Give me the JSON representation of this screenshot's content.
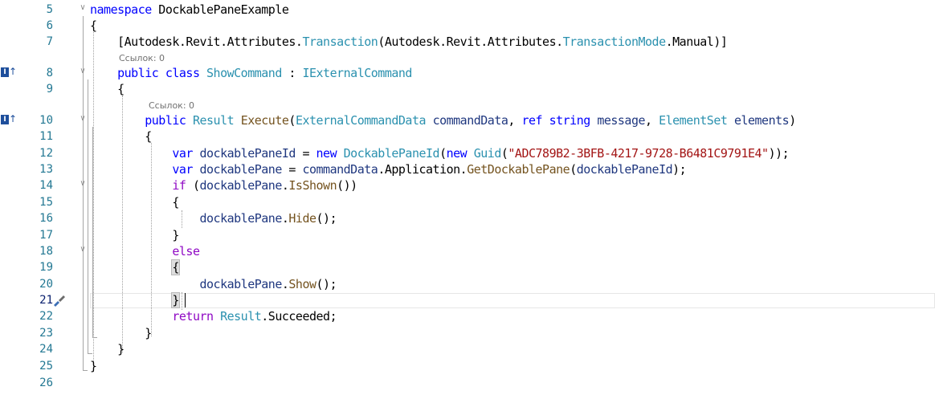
{
  "editor": {
    "lines": [
      {
        "num": "5",
        "tokens": [
          {
            "t": "namespace",
            "c": "kw"
          },
          {
            "t": " DockablePaneExample",
            "c": "ns"
          }
        ]
      },
      {
        "num": "6",
        "tokens": [
          {
            "t": "{",
            "c": ""
          }
        ]
      },
      {
        "num": "7",
        "tokens": [
          {
            "t": "    [Autodesk.Revit.Attributes.",
            "c": ""
          },
          {
            "t": "Transaction",
            "c": "typ"
          },
          {
            "t": "(Autodesk.Revit.Attributes.",
            "c": ""
          },
          {
            "t": "TransactionMode",
            "c": "typ"
          },
          {
            "t": ".Manual)]",
            "c": ""
          }
        ]
      },
      {
        "num": "8",
        "tokens": [
          {
            "t": "    ",
            "c": ""
          },
          {
            "t": "public",
            "c": "kw"
          },
          {
            "t": " ",
            "c": ""
          },
          {
            "t": "class",
            "c": "kw"
          },
          {
            "t": " ",
            "c": ""
          },
          {
            "t": "ShowCommand",
            "c": "typ"
          },
          {
            "t": " : ",
            "c": ""
          },
          {
            "t": "IExternalCommand",
            "c": "typ"
          }
        ]
      },
      {
        "num": "9",
        "tokens": [
          {
            "t": "    {",
            "c": ""
          }
        ]
      },
      {
        "num": "10",
        "tokens": [
          {
            "t": "        ",
            "c": ""
          },
          {
            "t": "public",
            "c": "kw"
          },
          {
            "t": " ",
            "c": ""
          },
          {
            "t": "Result",
            "c": "typ"
          },
          {
            "t": " ",
            "c": ""
          },
          {
            "t": "Execute",
            "c": "mth"
          },
          {
            "t": "(",
            "c": ""
          },
          {
            "t": "ExternalCommandData",
            "c": "typ"
          },
          {
            "t": " ",
            "c": ""
          },
          {
            "t": "commandData",
            "c": "var"
          },
          {
            "t": ", ",
            "c": ""
          },
          {
            "t": "ref",
            "c": "kw"
          },
          {
            "t": " ",
            "c": ""
          },
          {
            "t": "string",
            "c": "kw"
          },
          {
            "t": " ",
            "c": ""
          },
          {
            "t": "message",
            "c": "var"
          },
          {
            "t": ", ",
            "c": ""
          },
          {
            "t": "ElementSet",
            "c": "typ"
          },
          {
            "t": " ",
            "c": ""
          },
          {
            "t": "elements",
            "c": "var"
          },
          {
            "t": ")",
            "c": ""
          }
        ]
      },
      {
        "num": "11",
        "tokens": [
          {
            "t": "        {",
            "c": ""
          }
        ]
      },
      {
        "num": "12",
        "tokens": [
          {
            "t": "            ",
            "c": ""
          },
          {
            "t": "var",
            "c": "kw"
          },
          {
            "t": " ",
            "c": ""
          },
          {
            "t": "dockablePaneId",
            "c": "var"
          },
          {
            "t": " = ",
            "c": ""
          },
          {
            "t": "new",
            "c": "kw"
          },
          {
            "t": " ",
            "c": ""
          },
          {
            "t": "DockablePaneId",
            "c": "typ"
          },
          {
            "t": "(",
            "c": ""
          },
          {
            "t": "new",
            "c": "kw"
          },
          {
            "t": " ",
            "c": ""
          },
          {
            "t": "Guid",
            "c": "typ"
          },
          {
            "t": "(",
            "c": ""
          },
          {
            "t": "\"ADC789B2-3BFB-4217-9728-B6481C9791E4\"",
            "c": "str"
          },
          {
            "t": "));",
            "c": ""
          }
        ]
      },
      {
        "num": "13",
        "tokens": [
          {
            "t": "            ",
            "c": ""
          },
          {
            "t": "var",
            "c": "kw"
          },
          {
            "t": " ",
            "c": ""
          },
          {
            "t": "dockablePane",
            "c": "var"
          },
          {
            "t": " = ",
            "c": ""
          },
          {
            "t": "commandData",
            "c": "var"
          },
          {
            "t": ".Application.",
            "c": ""
          },
          {
            "t": "GetDockablePane",
            "c": "mth"
          },
          {
            "t": "(",
            "c": ""
          },
          {
            "t": "dockablePaneId",
            "c": "var"
          },
          {
            "t": ");",
            "c": ""
          }
        ]
      },
      {
        "num": "14",
        "tokens": [
          {
            "t": "            ",
            "c": ""
          },
          {
            "t": "if",
            "c": "ctl"
          },
          {
            "t": " (",
            "c": ""
          },
          {
            "t": "dockablePane",
            "c": "var"
          },
          {
            "t": ".",
            "c": ""
          },
          {
            "t": "IsShown",
            "c": "mth"
          },
          {
            "t": "())",
            "c": ""
          }
        ]
      },
      {
        "num": "15",
        "tokens": [
          {
            "t": "            {",
            "c": ""
          }
        ]
      },
      {
        "num": "16",
        "tokens": [
          {
            "t": "                ",
            "c": ""
          },
          {
            "t": "dockablePane",
            "c": "var"
          },
          {
            "t": ".",
            "c": ""
          },
          {
            "t": "Hide",
            "c": "mth"
          },
          {
            "t": "();",
            "c": ""
          }
        ]
      },
      {
        "num": "17",
        "tokens": [
          {
            "t": "            }",
            "c": ""
          }
        ]
      },
      {
        "num": "18",
        "tokens": [
          {
            "t": "            ",
            "c": ""
          },
          {
            "t": "else",
            "c": "ctl"
          }
        ]
      },
      {
        "num": "19",
        "tokens": [
          {
            "t": "            ",
            "c": ""
          },
          {
            "t": "{",
            "c": "bhl"
          }
        ]
      },
      {
        "num": "20",
        "tokens": [
          {
            "t": "                ",
            "c": ""
          },
          {
            "t": "dockablePane",
            "c": "var"
          },
          {
            "t": ".",
            "c": ""
          },
          {
            "t": "Show",
            "c": "mth"
          },
          {
            "t": "();",
            "c": ""
          }
        ]
      },
      {
        "num": "21",
        "tokens": [
          {
            "t": "            ",
            "c": ""
          },
          {
            "t": "}",
            "c": "bhl"
          }
        ]
      },
      {
        "num": "22",
        "tokens": [
          {
            "t": "            ",
            "c": ""
          },
          {
            "t": "return",
            "c": "ctl"
          },
          {
            "t": " ",
            "c": ""
          },
          {
            "t": "Result",
            "c": "typ"
          },
          {
            "t": ".Succeeded;",
            "c": ""
          }
        ]
      },
      {
        "num": "23",
        "tokens": [
          {
            "t": "        }",
            "c": ""
          }
        ]
      },
      {
        "num": "24",
        "tokens": [
          {
            "t": "    }",
            "c": ""
          }
        ]
      },
      {
        "num": "25",
        "tokens": [
          {
            "t": "}",
            "c": ""
          }
        ]
      },
      {
        "num": "26",
        "tokens": []
      }
    ],
    "codelens": [
      {
        "text": "Ссылок: 0",
        "before_line": "8"
      },
      {
        "text": "Ссылок: 0",
        "before_line": "10"
      }
    ],
    "current_line": "21",
    "info_marker_glyph": "I",
    "info_marker_arrow": "↑",
    "info_marker_lines": [
      "8",
      "10"
    ],
    "brush_icon_line": "21",
    "fold_glyph": "∨",
    "colors": {
      "keyword": "#0000ff",
      "control_keyword": "#8f08c4",
      "type": "#2b91af",
      "string": "#a31515",
      "method": "#74531f",
      "variable": "#1f377f",
      "line_number": "#237893"
    }
  }
}
